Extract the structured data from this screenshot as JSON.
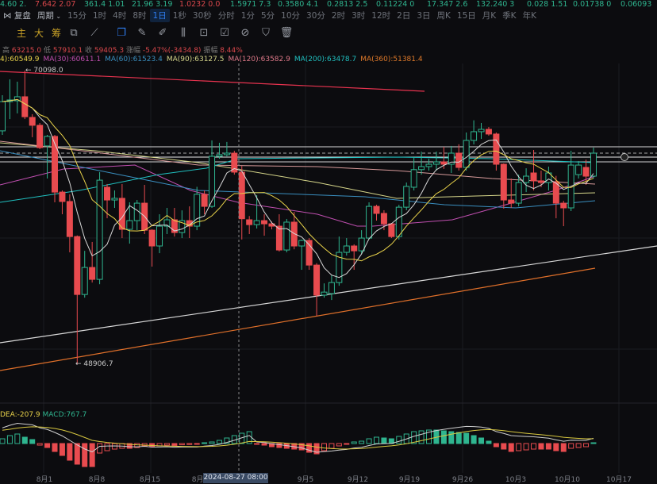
{
  "ticker": [
    {
      "text": "4.60  2.",
      "color": "#2fb58f"
    },
    {
      "text": "7.642  2.07",
      "color": "#d9474b"
    },
    {
      "text": "361.4  1.01",
      "color": "#2fb58f"
    },
    {
      "text": "21.96  3.19",
      "color": "#2fb58f"
    },
    {
      "text": "1.0232  0.0",
      "color": "#d9474b"
    },
    {
      "text": "1.5971  7.3",
      "color": "#2fb58f"
    },
    {
      "text": "0.3580  4.1",
      "color": "#2fb58f"
    },
    {
      "text": "0.2813  2.5",
      "color": "#2fb58f"
    },
    {
      "text": "0.11224  0",
      "color": "#2fb58f"
    },
    {
      "text": "17.347  2.6",
      "color": "#2fb58f"
    },
    {
      "text": "132.240  3",
      "color": "#2fb58f"
    },
    {
      "text": "0.028  1.51",
      "color": "#2fb58f"
    },
    {
      "text": "0.01738  0",
      "color": "#2fb58f"
    },
    {
      "text": "0.06093",
      "color": "#2fb58f"
    }
  ],
  "toolbar": {
    "replay": "复盘",
    "period": "周期",
    "active": "1日",
    "intervals": [
      "15分",
      "1时",
      "4时",
      "8时",
      "1日",
      "1秒",
      "30秒",
      "分时",
      "1分",
      "5分",
      "10分",
      "30分",
      "2时",
      "3时",
      "12时",
      "2日",
      "3日",
      "周K",
      "15日",
      "月K",
      "季K",
      "年K"
    ],
    "main": "主",
    "big": "大",
    "chips": "筹"
  },
  "ohlc": {
    "high_label": "高",
    "high": "63215.0",
    "low_label": "低",
    "low": "57910.1",
    "close_label": "收",
    "close": "59405.3",
    "change_label": "涨幅",
    "change": "-5.47%(-3434.8)",
    "amp_label": "振幅",
    "amp": "8.44%"
  },
  "ma_legend": [
    {
      "text": "4):60549.9",
      "color": "#e8d24a"
    },
    {
      "text": "MA(30):60611.1",
      "color": "#c04fb0"
    },
    {
      "text": "MA(60):61523.4",
      "color": "#3a8fc0"
    },
    {
      "text": "MA(90):63127.5",
      "color": "#d6d68a"
    },
    {
      "text": "MA(120):63582.9",
      "color": "#e07a8a"
    },
    {
      "text": "MA(200):63478.7",
      "color": "#20c0c0"
    },
    {
      "text": "MA(360):51381.4",
      "color": "#e07a2a"
    }
  ],
  "macd_legend": {
    "dea": "DEA:-207.9",
    "macd": "MACD:767.7"
  },
  "annotations": {
    "high_marker": "← 70098.0",
    "low_marker": "← 48906.7"
  },
  "crosshair": {
    "label": "2024-08-27 08:00"
  },
  "xaxis": [
    "8月1",
    "8月8",
    "8月15",
    "8月2",
    "9月5",
    "9月12",
    "9月19",
    "9月26",
    "10月3",
    "10月10",
    "10月17"
  ],
  "colors": {
    "up": "#2fb58f",
    "down": "#e84b4f",
    "ma5": "#d8d8d8",
    "ma10": "#e8d24a"
  },
  "chart_data": {
    "type": "candlestick",
    "price_range": [
      48906.7,
      70098.0
    ],
    "candles": [
      [
        65750,
        68320,
        65460,
        67860
      ],
      [
        67860,
        69470,
        66600,
        67980
      ],
      [
        67920,
        69300,
        67010,
        68210
      ],
      [
        68210,
        70098,
        66600,
        66770
      ],
      [
        66720,
        66950,
        65290,
        66150
      ],
      [
        66150,
        66320,
        64430,
        64540
      ],
      [
        64660,
        65460,
        62310,
        65350
      ],
      [
        65350,
        65460,
        60590,
        61330
      ],
      [
        61330,
        61450,
        59730,
        60650
      ],
      [
        60650,
        61170,
        56980,
        58120
      ],
      [
        58120,
        58200,
        48906.7,
        53940
      ],
      [
        53940,
        57090,
        53710,
        55890
      ],
      [
        55890,
        57730,
        54800,
        55030
      ],
      [
        55030,
        62770,
        54680,
        62190
      ],
      [
        61680,
        61910,
        59440,
        60760
      ],
      [
        60760,
        61450,
        60190,
        60880
      ],
      [
        60880,
        61910,
        58010,
        58640
      ],
      [
        58640,
        60590,
        57610,
        59270
      ],
      [
        59270,
        60760,
        58580,
        60530
      ],
      [
        60530,
        61850,
        58300,
        58580
      ],
      [
        58580,
        58640,
        55950,
        57440
      ],
      [
        57440,
        59730,
        56920,
        58870
      ],
      [
        58870,
        60190,
        58300,
        59330
      ],
      [
        59330,
        60190,
        58120,
        58410
      ],
      [
        58410,
        60010,
        58010,
        59270
      ],
      [
        59270,
        60300,
        58010,
        58870
      ],
      [
        58870,
        61710,
        58580,
        61170
      ],
      [
        61170,
        61450,
        59730,
        60300
      ],
      [
        60300,
        65060,
        60190,
        63910
      ],
      [
        63910,
        64890,
        63740,
        64030
      ],
      [
        64030,
        64950,
        63910,
        64140
      ],
      [
        64140,
        64310,
        62590,
        62770
      ],
      [
        62770,
        63215,
        57910.1,
        59405.3
      ],
      [
        59330,
        59600,
        58300,
        58980
      ],
      [
        58980,
        61110,
        58700,
        59270
      ],
      [
        59270,
        59730,
        58180,
        59040
      ],
      [
        59040,
        59200,
        58640,
        58870
      ],
      [
        58870,
        59730,
        57040,
        57150
      ],
      [
        57150,
        59390,
        56980,
        59160
      ],
      [
        59160,
        59900,
        57200,
        57440
      ],
      [
        57440,
        57900,
        55720,
        57840
      ],
      [
        57840,
        58010,
        55720,
        56060
      ],
      [
        56060,
        56200,
        52390,
        53890
      ],
      [
        53890,
        54740,
        53710,
        54110
      ],
      [
        54000,
        55320,
        53540,
        54800
      ],
      [
        54800,
        58120,
        54570,
        56980
      ],
      [
        56980,
        58010,
        56750,
        57440
      ],
      [
        57440,
        57560,
        55720,
        57090
      ],
      [
        57090,
        58580,
        56860,
        58010
      ],
      [
        58010,
        60590,
        57900,
        60300
      ],
      [
        60300,
        60410,
        59270,
        59790
      ],
      [
        59790,
        60020,
        58580,
        59040
      ],
      [
        59040,
        59100,
        58010,
        58120
      ],
      [
        58120,
        60410,
        57900,
        60240
      ],
      [
        60240,
        62020,
        60020,
        61740
      ],
      [
        61680,
        63850,
        61450,
        62950
      ],
      [
        62950,
        64250,
        62590,
        63170
      ],
      [
        63170,
        63740,
        62880,
        63340
      ],
      [
        63340,
        64250,
        62880,
        63510
      ],
      [
        63510,
        64600,
        63000,
        63340
      ],
      [
        63340,
        64660,
        62710,
        64140
      ],
      [
        64140,
        64780,
        62880,
        63110
      ],
      [
        63110,
        65630,
        62880,
        65060
      ],
      [
        65060,
        66510,
        64770,
        65690
      ],
      [
        65690,
        66320,
        65170,
        65860
      ],
      [
        65860,
        66030,
        65400,
        65520
      ],
      [
        65520,
        65630,
        62880,
        63340
      ],
      [
        63340,
        63400,
        60130,
        60760
      ],
      [
        60760,
        62310,
        60190,
        60530
      ],
      [
        60530,
        62590,
        60300,
        62020
      ],
      [
        62020,
        63050,
        61330,
        62480
      ],
      [
        62710,
        64370,
        61450,
        62140
      ],
      [
        62140,
        62880,
        61680,
        62020
      ],
      [
        62020,
        63170,
        61450,
        62710
      ],
      [
        62080,
        62500,
        59440,
        60530
      ],
      [
        60530,
        60700,
        58870,
        60190
      ],
      [
        60190,
        64310,
        59960,
        63280
      ],
      [
        62590,
        63570,
        62310,
        63280
      ],
      [
        63110,
        63670,
        61850,
        62480
      ],
      [
        62480,
        64540,
        62310,
        64140
      ]
    ],
    "macd_hist": [
      300,
      500,
      600,
      400,
      250,
      -100,
      -250,
      -500,
      -750,
      -1050,
      -1300,
      -1450,
      -1450,
      -600,
      -450,
      -350,
      -300,
      -300,
      -250,
      -150,
      -200,
      -150,
      -100,
      -120,
      -80,
      -60,
      -50,
      50,
      100,
      200,
      350,
      500,
      650,
      750,
      -50,
      -100,
      -200,
      -250,
      -300,
      -350,
      -400,
      -550,
      -650,
      -450,
      -300,
      -150,
      -50,
      100,
      150,
      300,
      400,
      350,
      300,
      450,
      600,
      750,
      800,
      850,
      850,
      800,
      750,
      700,
      650,
      500,
      350,
      150,
      -200,
      -350,
      -500,
      -450,
      -400,
      -350,
      -350,
      -350,
      -450,
      -500,
      -300,
      -250,
      -200,
      50
    ],
    "dea_start": 800
  }
}
